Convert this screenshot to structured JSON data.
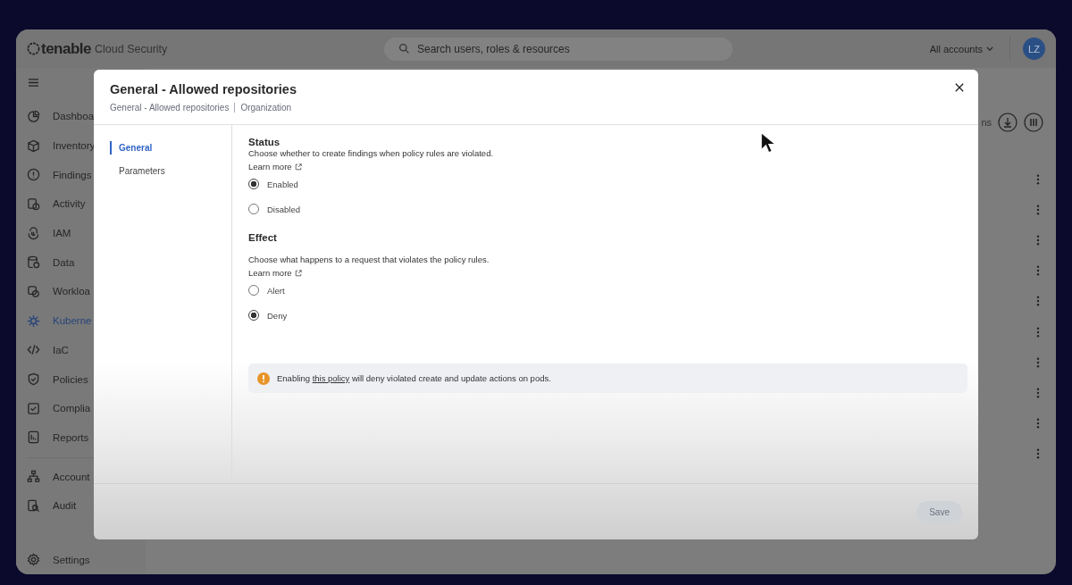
{
  "app": {
    "logo": "tenable",
    "product": "Cloud Security",
    "search": {
      "placeholder": "Search users, roles & resources"
    },
    "account_menu": "All accounts",
    "avatar": "LZ"
  },
  "sidebar": {
    "groups": [
      [
        {
          "label": "Dashboa",
          "selected": false
        },
        {
          "label": "Inventory",
          "selected": false
        },
        {
          "label": "Findings",
          "selected": false
        },
        {
          "label": "Activity",
          "selected": false
        },
        {
          "label": "IAM",
          "selected": false
        },
        {
          "label": "Data",
          "selected": false
        },
        {
          "label": "Workloa",
          "selected": false
        },
        {
          "label": "Kuberne",
          "selected": true
        },
        {
          "label": "IaC",
          "selected": false
        },
        {
          "label": "Policies",
          "selected": false
        },
        {
          "label": "Complia",
          "selected": false
        },
        {
          "label": "Reports",
          "selected": false
        }
      ],
      [
        {
          "label": "Account",
          "selected": false
        },
        {
          "label": "Audit",
          "selected": false
        }
      ],
      [
        {
          "label": "Settings",
          "selected": false
        }
      ]
    ]
  },
  "main": {
    "toolbar_text": "ns"
  },
  "dialog": {
    "title": "General - Allowed repositories",
    "breadcrumb": [
      "General - Allowed repositories",
      "Organization"
    ],
    "nav": [
      {
        "label": "General",
        "selected": true
      },
      {
        "label": "Parameters",
        "selected": false
      }
    ],
    "sections": [
      {
        "heading": "Status",
        "description": "Choose whether to create findings when policy rules are violated.",
        "link": "Learn more",
        "options": [
          {
            "label": "Enabled",
            "selected": true
          },
          {
            "label": "Disabled",
            "selected": false
          }
        ]
      },
      {
        "heading": "Effect",
        "description": "Choose what happens to a request that violates the policy rules.",
        "link": "Learn more",
        "options": [
          {
            "label": "Alert",
            "selected": false
          },
          {
            "label": "Deny",
            "selected": true
          }
        ]
      }
    ],
    "notice": {
      "before": "Enabling ",
      "link": "this policy",
      "after": " will deny violated create and update actions on pods."
    },
    "save_button": {
      "label": "Save",
      "disabled": true
    }
  }
}
